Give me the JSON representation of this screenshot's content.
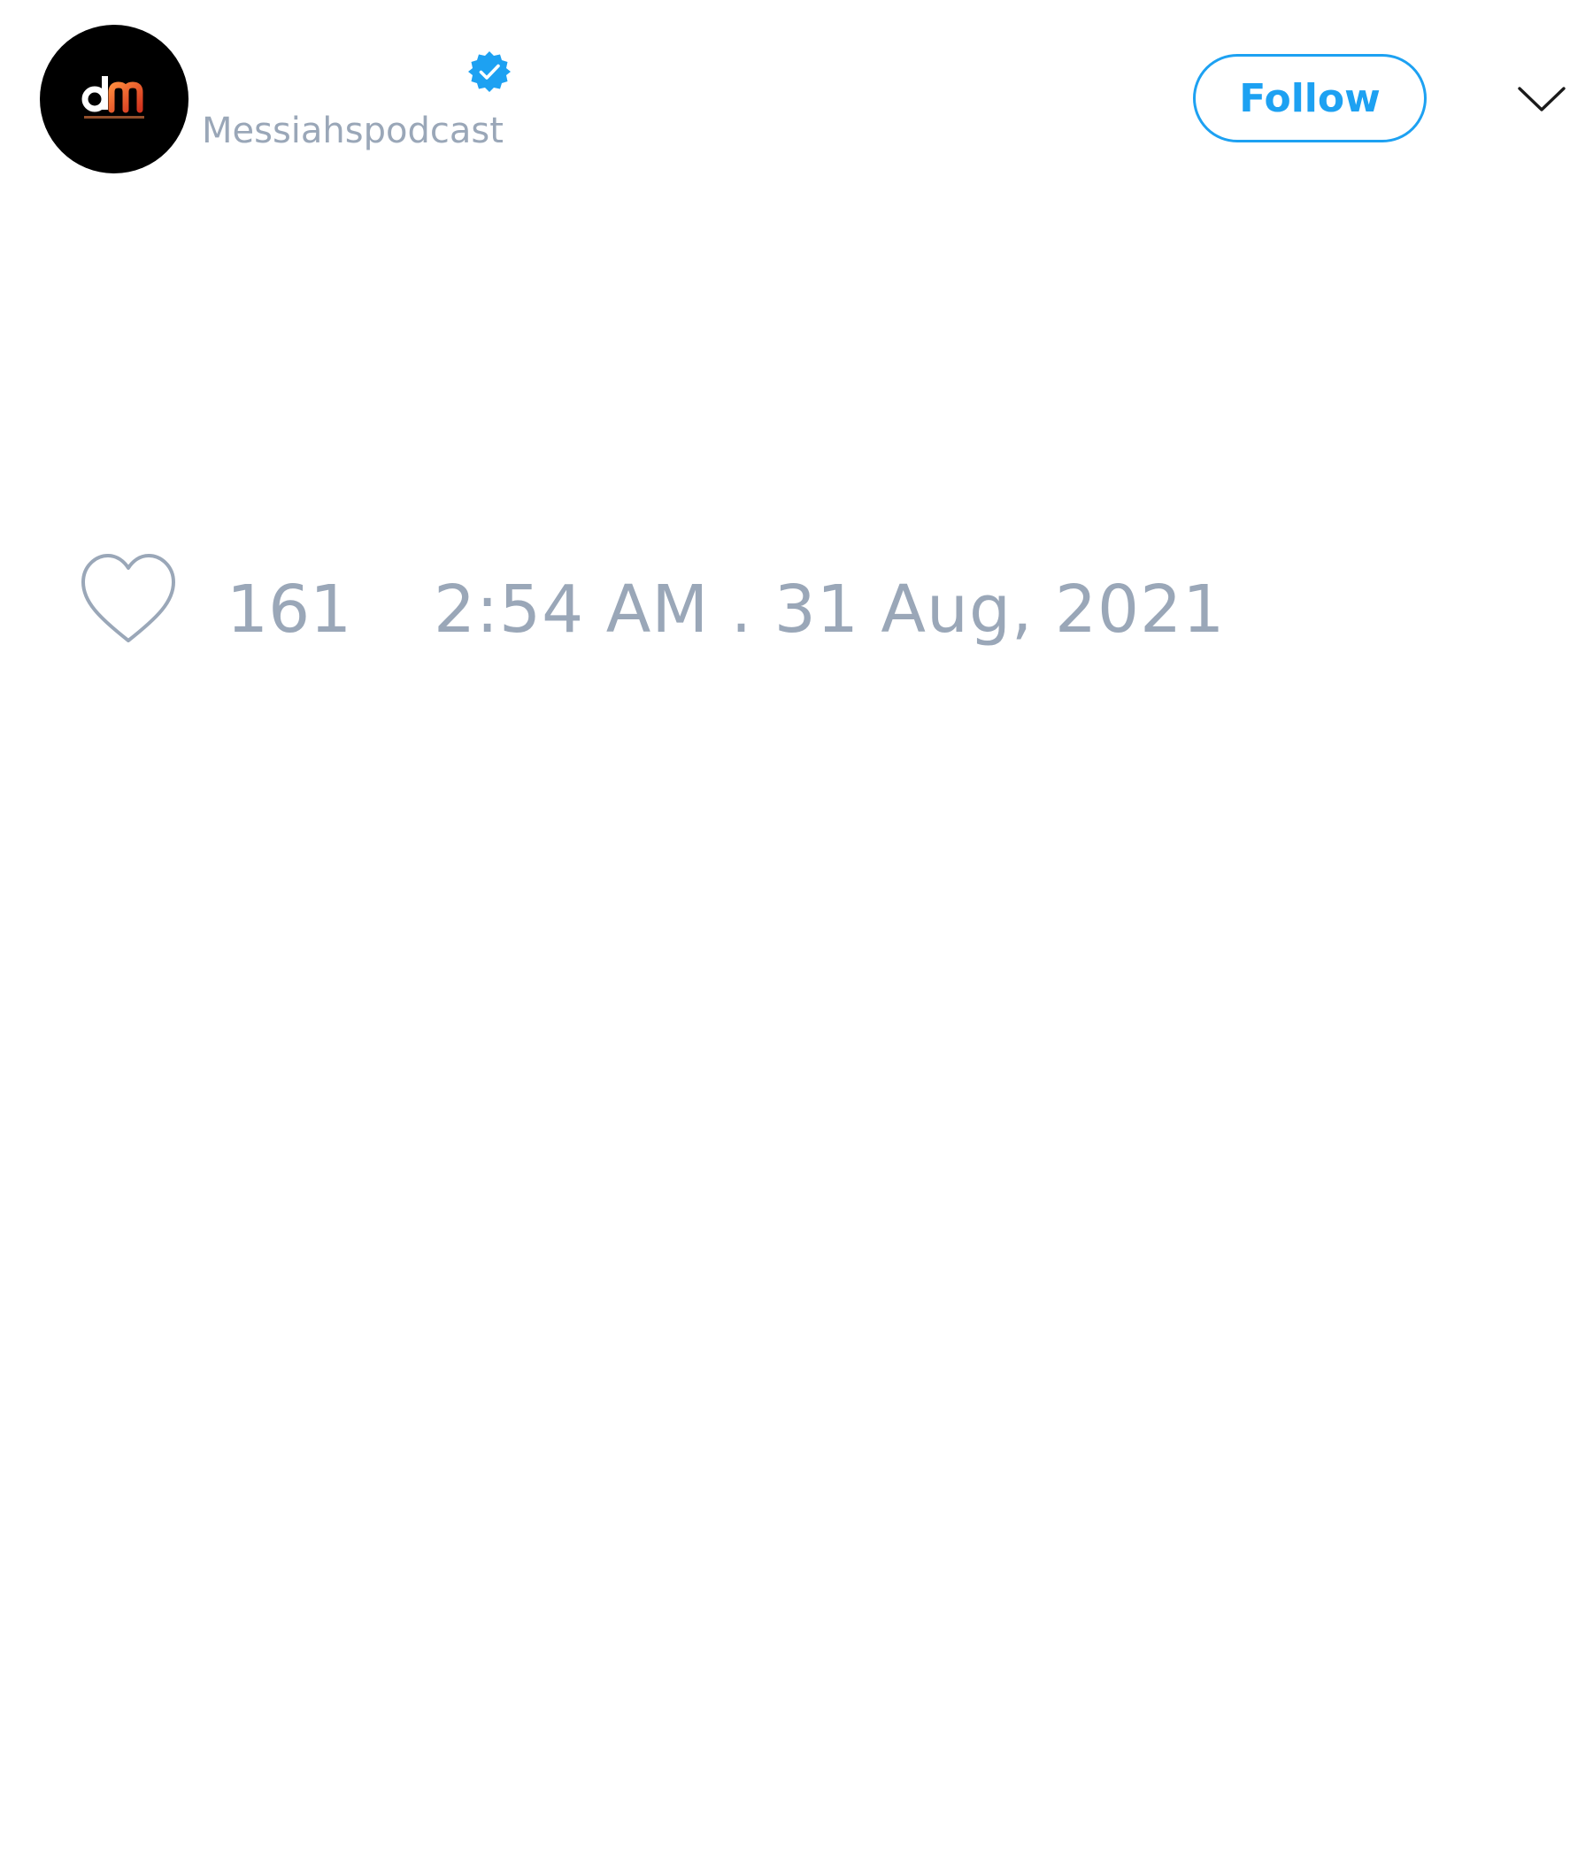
{
  "tweet": {
    "author": {
      "handle": "Messiahspodcast",
      "verified": true,
      "avatar_icon": "dm-logo-avatar"
    },
    "actions": {
      "follow_label": "Follow",
      "more_icon": "chevron-down-icon"
    },
    "stats": {
      "like_icon": "heart-outline-icon",
      "like_count": "161",
      "timestamp": "2:54 AM . 31 Aug, 2021"
    }
  },
  "colors": {
    "accent": "#1da1f2",
    "muted_text": "#9aa7b8",
    "background": "#ffffff",
    "avatar_bg": "#000000"
  }
}
